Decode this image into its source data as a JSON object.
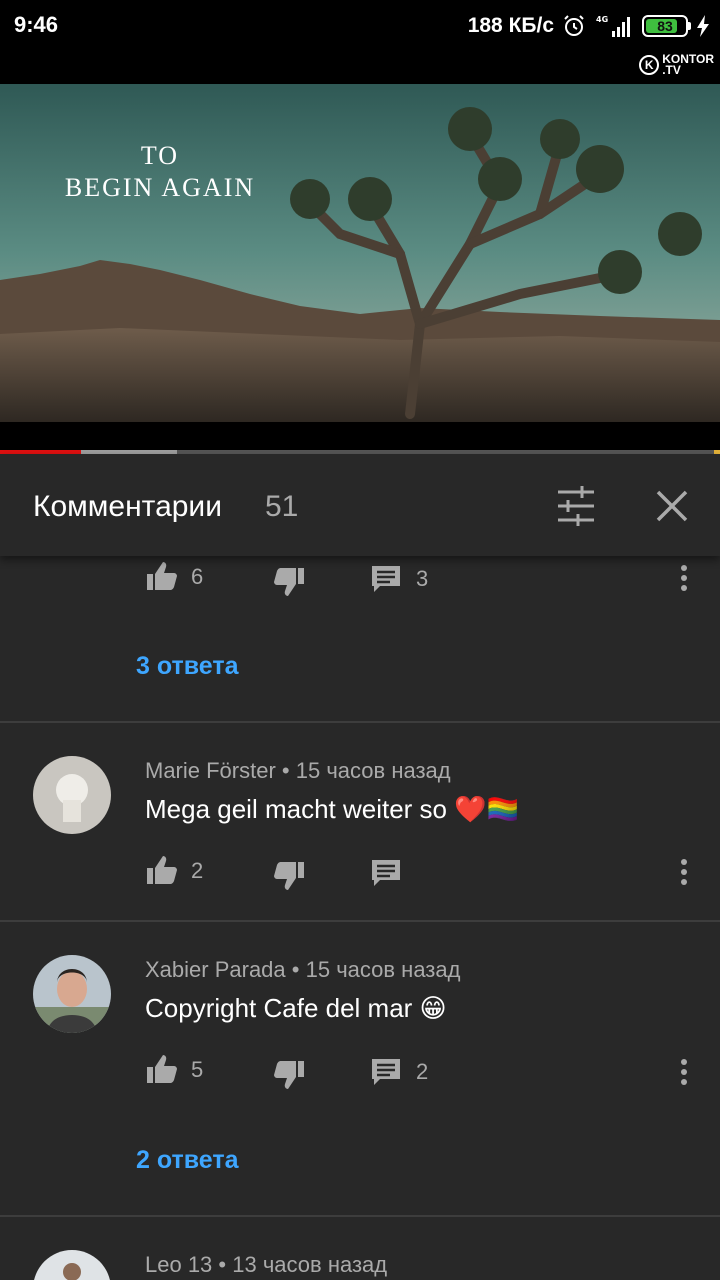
{
  "status_bar": {
    "time": "9:46",
    "net_speed": "188 КБ/с",
    "network": "4G",
    "battery": "83",
    "battery_level_percent": 83
  },
  "video": {
    "title_line1": "TO",
    "title_line2": "BEGIN AGAIN",
    "channel_logo_text": "KONTOR",
    "channel_logo_sub": ".TV",
    "progress_played_percent": 11.3,
    "progress_buffered_percent": 24.6,
    "colors": {
      "played": "#e01010",
      "buffered": "#9e9e9e"
    }
  },
  "comments_panel": {
    "title": "Комментарии",
    "count": "51",
    "filter_icon": "sort-filter-icon",
    "close_icon": "close-icon"
  },
  "comments": [
    {
      "likes": "6",
      "reply_count": "3",
      "replies_label": "3 ответа"
    },
    {
      "author": "Marie Förster",
      "time": "15 часов назад",
      "text": "Mega geil macht weiter so ❤️🏳️‍🌈",
      "likes": "2",
      "reply_count": ""
    },
    {
      "author": "Xabier Parada",
      "time": "15 часов назад",
      "text": "Copyright Cafe del mar 😁",
      "likes": "5",
      "reply_count": "2",
      "replies_label": "2 ответа"
    },
    {
      "author": "Leo 13",
      "time": "13 часов назад"
    }
  ],
  "colors": {
    "link": "#3ea6ff",
    "background": "#282828",
    "muted_text": "#aaaaaa"
  }
}
